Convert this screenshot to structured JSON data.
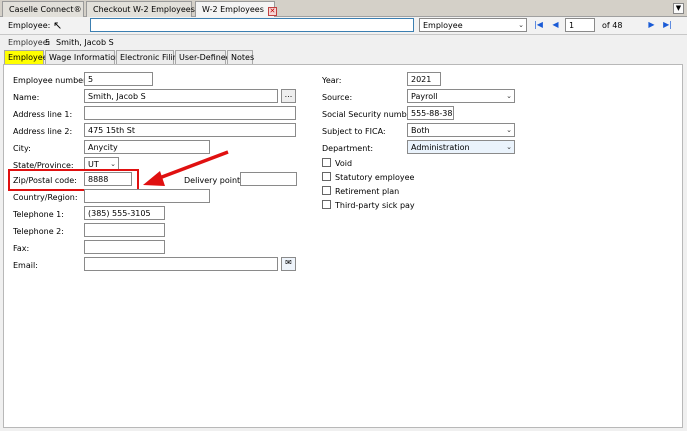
{
  "tabs": [
    {
      "label": "Caselle Connect®"
    },
    {
      "label": "Checkout W-2 Employees"
    },
    {
      "label": "W-2 Employees"
    }
  ],
  "search": {
    "label": "Employee:",
    "value": "",
    "type_value": "Employee",
    "record_value": "1",
    "record_total": "of 48"
  },
  "current": {
    "label": "Employee:",
    "number": "5",
    "name": "Smith, Jacob S"
  },
  "subtabs": [
    "Employee",
    "Wage Information",
    "Electronic Filing",
    "User-Defined",
    "Notes"
  ],
  "form": {
    "employee_number_label": "Employee number:",
    "employee_number": "5",
    "name_label": "Name:",
    "name": "Smith, Jacob S",
    "name_btn": "...",
    "address1_label": "Address line 1:",
    "address1": "",
    "address2_label": "Address line 2:",
    "address2": "475 15th St",
    "city_label": "City:",
    "city": "Anycity",
    "state_label": "State/Province:",
    "state": "UT",
    "zip_label": "Zip/Postal code:",
    "zip": "8888",
    "delivery_label": "Delivery point:",
    "delivery": "",
    "country_label": "Country/Region:",
    "country": "",
    "tel1_label": "Telephone 1:",
    "tel1": "(385) 555-3105",
    "tel2_label": "Telephone 2:",
    "tel2": "",
    "fax_label": "Fax:",
    "fax": "",
    "email_label": "Email:",
    "email": ""
  },
  "right": {
    "year_label": "Year:",
    "year": "2021",
    "source_label": "Source:",
    "source": "Payroll",
    "ssn_label": "Social Security number:",
    "ssn": "555-88-3878",
    "fica_label": "Subject to FICA:",
    "fica": "Both",
    "dept_label": "Department:",
    "dept": "Administration",
    "checks": [
      "Void",
      "Statutory employee",
      "Retirement plan",
      "Third-party sick pay"
    ]
  },
  "colors": {
    "highlight": "#ffff00",
    "annotation": "#e01010"
  }
}
